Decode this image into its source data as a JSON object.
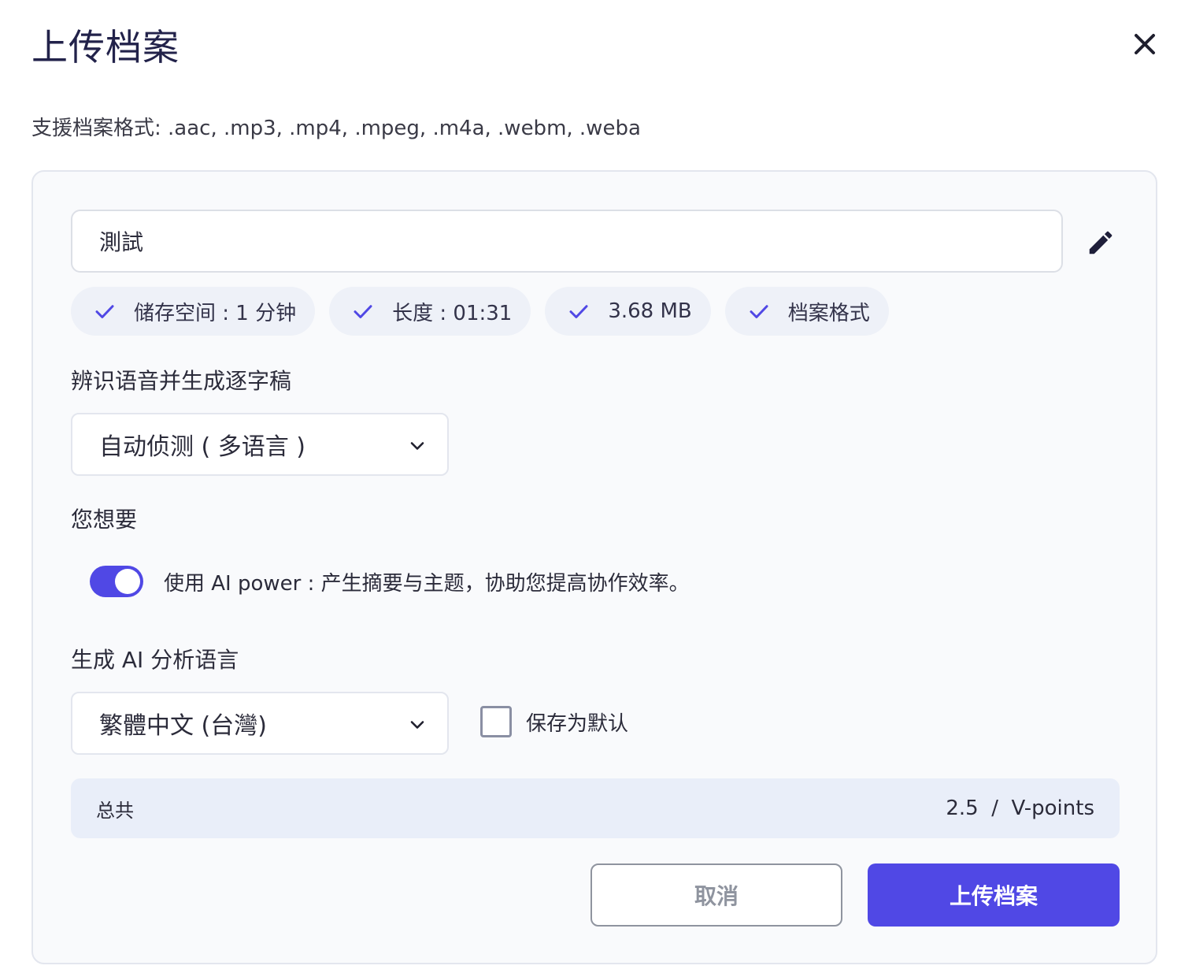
{
  "dialog": {
    "title": "上传档案",
    "formats": "支援档案格式: .aac, .mp3, .mp4, .mpeg, .m4a, .webm, .weba"
  },
  "file": {
    "name": "測試"
  },
  "chips": [
    {
      "label": "储存空间 : 1 分钟",
      "icon": "check-icon"
    },
    {
      "label": "长度 : 01:31",
      "icon": "check-icon"
    },
    {
      "label": "3.68 MB",
      "icon": "check-icon"
    },
    {
      "label": "档案格式",
      "icon": "check-icon"
    }
  ],
  "transcription": {
    "label": "辨识语音并生成逐字稿",
    "selected": "自动侦测 ( 多语言 )"
  },
  "options": {
    "label": "您想要",
    "ai_power_text": "使用 AI power : 产生摘要与主题，协助您提高协作效率。",
    "ai_power_enabled": true
  },
  "ai_language": {
    "label": "生成 AI 分析语言",
    "selected": "繁體中文 (台灣)",
    "save_default_label": "保存为默认",
    "save_default_checked": false
  },
  "total": {
    "label": "总共",
    "value": "2.5  /  V-points"
  },
  "buttons": {
    "cancel": "取消",
    "upload": "上传档案"
  },
  "colors": {
    "accent": "#5048e5",
    "check": "#5048e5",
    "panel_bg": "#f9fafc",
    "total_bg": "#e9eef9"
  }
}
